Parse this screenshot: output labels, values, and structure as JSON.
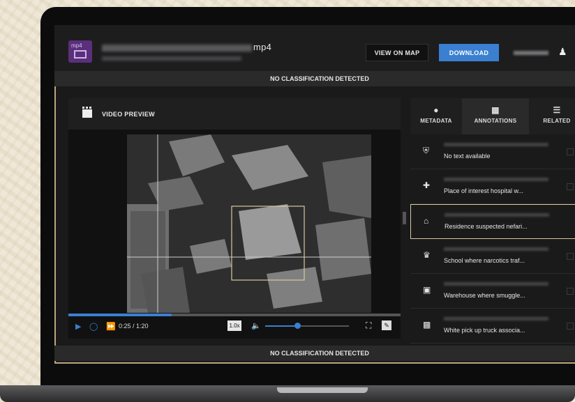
{
  "header": {
    "file_type": "mp4",
    "file_name_suffix": "mp4",
    "view_on_map_label": "VIEW ON MAP",
    "download_label": "DOWNLOAD"
  },
  "classification_top": "NO CLASSIFICATION DETECTED",
  "classification_bottom": "NO CLASSIFICATION DETECTED",
  "video": {
    "title": "VIDEO PREVIEW",
    "time": "0:25 / 1:20",
    "speed": "1.0x",
    "progress": 0.31,
    "volume": 0.38
  },
  "tabs": [
    {
      "label": "METADATA",
      "icon": "info-icon"
    },
    {
      "label": "ANNOTATIONS",
      "icon": "annotation-icon"
    },
    {
      "label": "RELATED",
      "icon": "list-icon"
    }
  ],
  "annotations": [
    {
      "icon": "shield-icon",
      "text": "No text available"
    },
    {
      "icon": "hospital-icon",
      "text": "Place of interest hospital w..."
    },
    {
      "icon": "home-icon",
      "text": "Residence suspected nefari..."
    },
    {
      "icon": "school-icon",
      "text": "School where narcotics traf..."
    },
    {
      "icon": "warehouse-icon",
      "text": "Warehouse where smuggle..."
    },
    {
      "icon": "truck-icon",
      "text": "White pick up truck associa..."
    }
  ],
  "colors": {
    "accent": "#3a7fd0",
    "frame": "#b9a67a",
    "file_icon": "#5a2f7c"
  }
}
